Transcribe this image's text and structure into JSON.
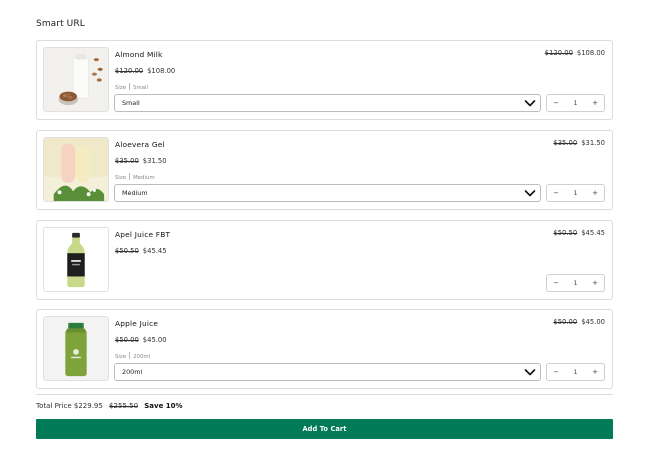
{
  "header": {
    "title": "Smart URL"
  },
  "products": [
    {
      "name": "Almond Milk",
      "original_price": "$120.00",
      "sale_price": "$108.00",
      "option_label": "Size",
      "option_value": "Small",
      "select_value": "Small",
      "quantity": "1"
    },
    {
      "name": "Aloevera Gel",
      "original_price": "$35.00",
      "sale_price": "$31.50",
      "option_label": "Size",
      "option_value": "Medium",
      "select_value": "Medium",
      "quantity": "1"
    },
    {
      "name": "Apel Juice FBT",
      "original_price": "$50.50",
      "sale_price": "$45.45",
      "quantity": "1"
    },
    {
      "name": "Apple Juice",
      "original_price": "$50.00",
      "sale_price": "$45.00",
      "option_label": "Size",
      "option_value": "200ml",
      "select_value": "200ml",
      "quantity": "1"
    }
  ],
  "qty_controls": {
    "minus": "−",
    "plus": "+"
  },
  "footer": {
    "total_label": "Total Price",
    "total_price": "$229.95",
    "original_total": "$255.50",
    "save_text": "Save 10%",
    "add_to_cart_label": "Add To Cart"
  },
  "colors": {
    "accent": "#007a57",
    "border": "#dcdcdc"
  },
  "icons": {
    "select_chevron": "chevron-down-icon"
  }
}
